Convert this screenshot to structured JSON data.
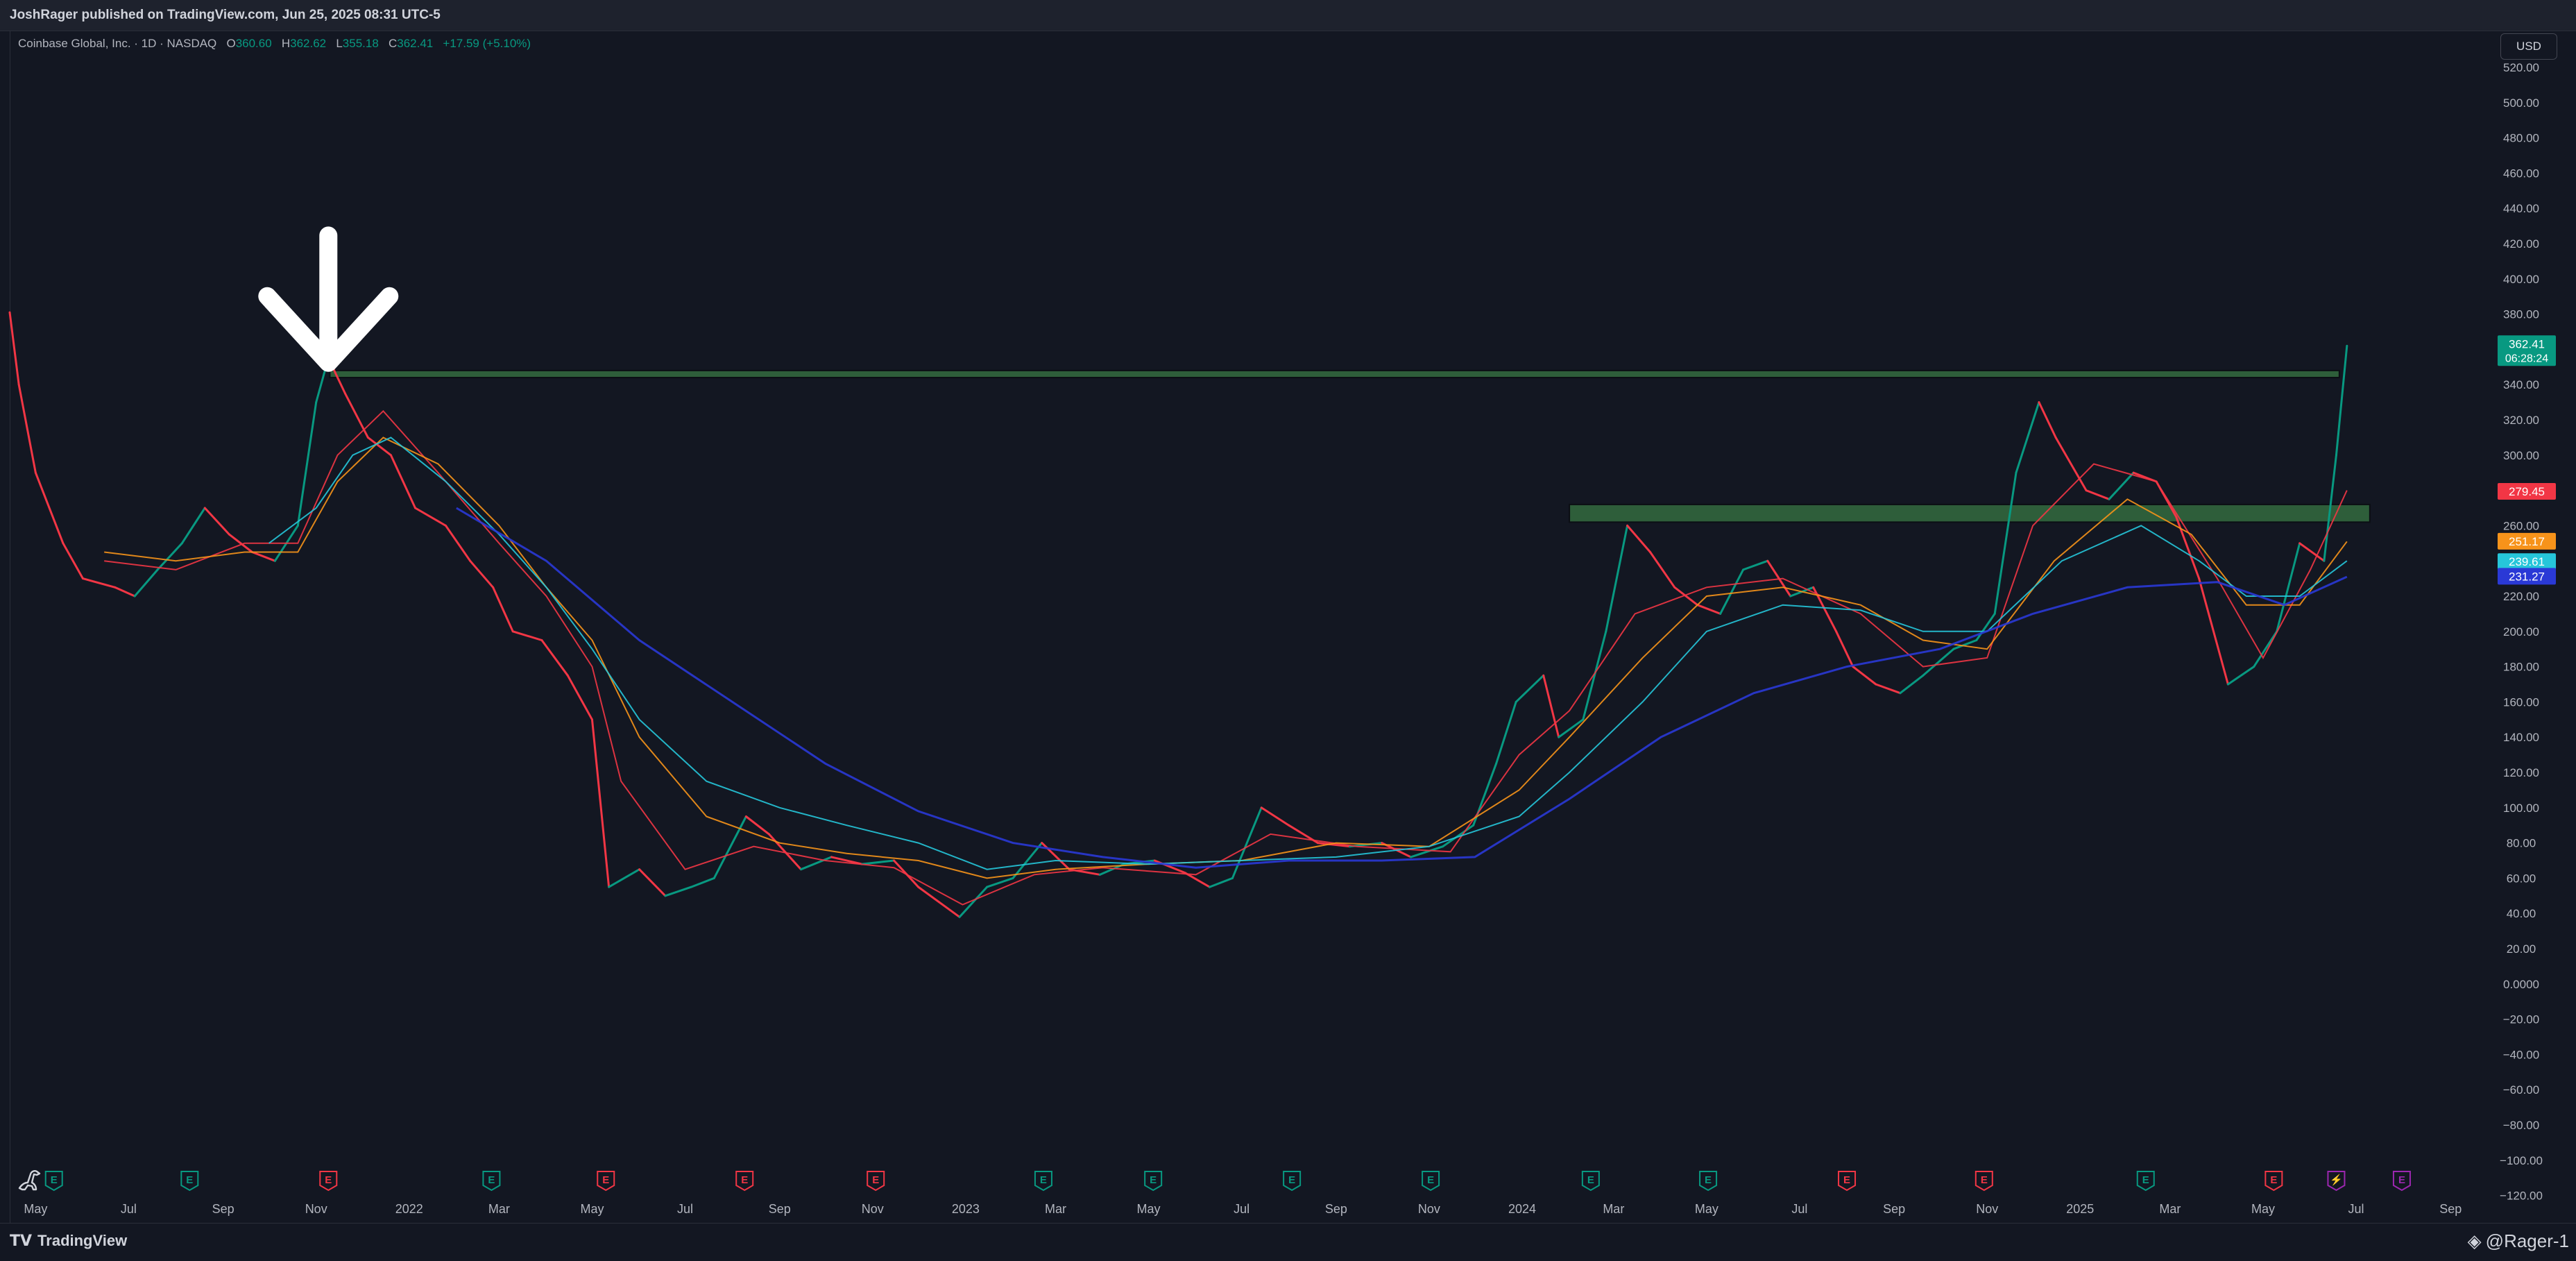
{
  "header": {
    "publish_info": "JoshRager published on TradingView.com, Jun 25, 2025 08:31 UTC-5"
  },
  "legend": {
    "symbol": "Coinbase Global, Inc. · 1D · NASDAQ",
    "open_label": "O",
    "open": "360.60",
    "high_label": "H",
    "high": "362.62",
    "low_label": "L",
    "low": "355.18",
    "close_label": "C",
    "close": "362.41",
    "change": "+17.59 (+5.10%)"
  },
  "currency": "USD",
  "footer": {
    "brand": "TradingView",
    "user": "@Rager-1"
  },
  "colors": {
    "background": "#131722",
    "up": "#089981",
    "down": "#f23645",
    "ma_red": "#f23645",
    "ma_orange": "#f7931a",
    "ma_teal": "#26c6da",
    "ma_blue": "#2a39d6",
    "zone": "#2e5e3a"
  },
  "chart_data": {
    "type": "line",
    "title": "",
    "xlabel": "",
    "ylabel": "",
    "ylim": [
      -120,
      525
    ],
    "x_range": [
      "2021-04-14",
      "2025-09-30"
    ],
    "y_ticks": [
      "520.00",
      "500.00",
      "480.00",
      "460.00",
      "440.00",
      "420.00",
      "400.00",
      "380.00",
      "360.00",
      "340.00",
      "320.00",
      "300.00",
      "280.00",
      "260.00",
      "240.00",
      "220.00",
      "200.00",
      "180.00",
      "160.00",
      "140.00",
      "120.00",
      "100.00",
      "80.00",
      "60.00",
      "40.00",
      "20.00",
      "0.0000",
      "−20.00",
      "−40.00",
      "−60.00",
      "−80.00",
      "−100.00",
      "−120.00"
    ],
    "x_ticks": [
      {
        "label": "May",
        "date": "2021-05-01"
      },
      {
        "label": "Jul",
        "date": "2021-07-01"
      },
      {
        "label": "Sep",
        "date": "2021-09-01"
      },
      {
        "label": "Nov",
        "date": "2021-11-01"
      },
      {
        "label": "2022",
        "date": "2022-01-01"
      },
      {
        "label": "Mar",
        "date": "2022-03-01"
      },
      {
        "label": "May",
        "date": "2022-05-01"
      },
      {
        "label": "Jul",
        "date": "2022-07-01"
      },
      {
        "label": "Sep",
        "date": "2022-09-01"
      },
      {
        "label": "Nov",
        "date": "2022-11-01"
      },
      {
        "label": "2023",
        "date": "2023-01-01"
      },
      {
        "label": "Mar",
        "date": "2023-03-01"
      },
      {
        "label": "May",
        "date": "2023-05-01"
      },
      {
        "label": "Jul",
        "date": "2023-07-01"
      },
      {
        "label": "Sep",
        "date": "2023-09-01"
      },
      {
        "label": "Nov",
        "date": "2023-11-01"
      },
      {
        "label": "2024",
        "date": "2024-01-01"
      },
      {
        "label": "Mar",
        "date": "2024-03-01"
      },
      {
        "label": "May",
        "date": "2024-05-01"
      },
      {
        "label": "Jul",
        "date": "2024-07-01"
      },
      {
        "label": "Sep",
        "date": "2024-09-01"
      },
      {
        "label": "Nov",
        "date": "2024-11-01"
      },
      {
        "label": "2025",
        "date": "2025-01-01"
      },
      {
        "label": "Mar",
        "date": "2025-03-01"
      },
      {
        "label": "May",
        "date": "2025-05-01"
      },
      {
        "label": "Jul",
        "date": "2025-07-01"
      },
      {
        "label": "Sep",
        "date": "2025-09-01"
      }
    ],
    "price": {
      "x": [
        "2021-04-14",
        "2021-04-20",
        "2021-05-01",
        "2021-05-19",
        "2021-06-01",
        "2021-06-22",
        "2021-07-05",
        "2021-07-20",
        "2021-08-05",
        "2021-08-20",
        "2021-09-05",
        "2021-09-20",
        "2021-10-05",
        "2021-10-20",
        "2021-11-01",
        "2021-11-09",
        "2021-11-20",
        "2021-12-05",
        "2021-12-20",
        "2022-01-05",
        "2022-01-25",
        "2022-02-10",
        "2022-02-25",
        "2022-03-10",
        "2022-03-29",
        "2022-04-15",
        "2022-05-01",
        "2022-05-12",
        "2022-06-01",
        "2022-06-18",
        "2022-07-05",
        "2022-07-20",
        "2022-08-10",
        "2022-08-25",
        "2022-09-15",
        "2022-10-05",
        "2022-10-25",
        "2022-11-15",
        "2022-12-01",
        "2022-12-28",
        "2023-01-15",
        "2023-02-01",
        "2023-02-20",
        "2023-03-10",
        "2023-03-30",
        "2023-04-15",
        "2023-05-05",
        "2023-05-25",
        "2023-06-10",
        "2023-06-25",
        "2023-07-14",
        "2023-08-01",
        "2023-08-20",
        "2023-09-10",
        "2023-10-01",
        "2023-10-20",
        "2023-11-10",
        "2023-11-30",
        "2023-12-15",
        "2023-12-28",
        "2024-01-15",
        "2024-01-25",
        "2024-02-10",
        "2024-02-25",
        "2024-03-10",
        "2024-03-25",
        "2024-04-10",
        "2024-04-25",
        "2024-05-10",
        "2024-05-25",
        "2024-06-10",
        "2024-06-25",
        "2024-07-10",
        "2024-07-25",
        "2024-08-05",
        "2024-08-20",
        "2024-09-05",
        "2024-09-20",
        "2024-10-10",
        "2024-10-25",
        "2024-11-06",
        "2024-11-20",
        "2024-12-05",
        "2024-12-16",
        "2025-01-05",
        "2025-01-20",
        "2025-02-05",
        "2025-02-20",
        "2025-03-05",
        "2025-03-20",
        "2025-04-08",
        "2025-04-25",
        "2025-05-10",
        "2025-05-25",
        "2025-06-10",
        "2025-06-18",
        "2025-06-25"
      ],
      "y": [
        381,
        340,
        290,
        250,
        230,
        225,
        220,
        235,
        250,
        270,
        255,
        245,
        240,
        260,
        330,
        355,
        335,
        310,
        300,
        270,
        260,
        240,
        225,
        200,
        195,
        175,
        150,
        55,
        65,
        50,
        55,
        60,
        95,
        85,
        65,
        72,
        68,
        70,
        55,
        38,
        55,
        60,
        80,
        65,
        62,
        68,
        70,
        63,
        55,
        60,
        100,
        90,
        80,
        78,
        80,
        72,
        78,
        90,
        125,
        160,
        175,
        140,
        150,
        200,
        260,
        245,
        225,
        215,
        210,
        235,
        240,
        220,
        225,
        200,
        180,
        170,
        165,
        175,
        190,
        195,
        210,
        290,
        330,
        310,
        280,
        275,
        290,
        285,
        265,
        230,
        170,
        180,
        200,
        250,
        240,
        300,
        362
      ]
    },
    "series": [
      {
        "color": "#f23645",
        "x": [
          "2021-06-15",
          "2021-08-01",
          "2021-09-15",
          "2021-10-20",
          "2021-11-15",
          "2021-12-15",
          "2022-01-20",
          "2022-03-01",
          "2022-04-01",
          "2022-05-01",
          "2022-05-20",
          "2022-07-01",
          "2022-08-15",
          "2022-10-01",
          "2022-11-15",
          "2022-12-30",
          "2023-02-15",
          "2023-04-01",
          "2023-06-01",
          "2023-07-20",
          "2023-09-15",
          "2023-11-15",
          "2023-12-30",
          "2024-02-01",
          "2024-03-15",
          "2024-05-01",
          "2024-06-20",
          "2024-08-10",
          "2024-09-20",
          "2024-11-01",
          "2024-12-01",
          "2025-01-10",
          "2025-02-20",
          "2025-04-01",
          "2025-05-01",
          "2025-06-01",
          "2025-06-25"
        ],
        "y": [
          240,
          235,
          250,
          250,
          300,
          325,
          290,
          250,
          220,
          180,
          115,
          65,
          78,
          70,
          66,
          45,
          62,
          66,
          62,
          85,
          78,
          75,
          130,
          155,
          210,
          225,
          230,
          210,
          180,
          185,
          260,
          295,
          285,
          230,
          185,
          235,
          280
        ]
      },
      {
        "color": "#f7931a",
        "x": [
          "2021-06-15",
          "2021-08-01",
          "2021-09-15",
          "2021-10-20",
          "2021-11-15",
          "2021-12-15",
          "2022-01-20",
          "2022-03-01",
          "2022-04-01",
          "2022-05-01",
          "2022-06-01",
          "2022-07-15",
          "2022-09-01",
          "2022-10-15",
          "2022-12-01",
          "2023-01-15",
          "2023-03-01",
          "2023-05-01",
          "2023-07-01",
          "2023-09-01",
          "2023-11-01",
          "2023-12-30",
          "2024-02-01",
          "2024-03-20",
          "2024-05-01",
          "2024-06-20",
          "2024-08-10",
          "2024-09-20",
          "2024-11-01",
          "2024-12-15",
          "2025-02-01",
          "2025-03-15",
          "2025-04-20",
          "2025-05-25",
          "2025-06-25"
        ],
        "y": [
          245,
          240,
          245,
          245,
          285,
          310,
          295,
          260,
          225,
          195,
          140,
          95,
          80,
          74,
          70,
          60,
          65,
          68,
          70,
          80,
          78,
          110,
          140,
          185,
          220,
          225,
          215,
          195,
          190,
          240,
          275,
          255,
          215,
          215,
          251
        ]
      },
      {
        "color": "#26c6da",
        "x": [
          "2021-10-01",
          "2021-11-01",
          "2021-11-25",
          "2021-12-20",
          "2022-01-25",
          "2022-03-01",
          "2022-04-01",
          "2022-05-01",
          "2022-06-01",
          "2022-07-15",
          "2022-09-01",
          "2022-10-15",
          "2022-12-01",
          "2023-01-15",
          "2023-03-01",
          "2023-05-01",
          "2023-07-01",
          "2023-09-01",
          "2023-11-01",
          "2023-12-30",
          "2024-02-01",
          "2024-03-20",
          "2024-05-01",
          "2024-06-20",
          "2024-08-10",
          "2024-09-20",
          "2024-11-01",
          "2024-12-20",
          "2025-02-10",
          "2025-03-20",
          "2025-04-20",
          "2025-05-25",
          "2025-06-25"
        ],
        "y": [
          250,
          270,
          300,
          310,
          285,
          255,
          225,
          190,
          150,
          115,
          100,
          90,
          80,
          65,
          70,
          68,
          70,
          72,
          78,
          95,
          120,
          160,
          200,
          215,
          212,
          200,
          200,
          240,
          260,
          240,
          220,
          220,
          240
        ]
      },
      {
        "color": "#2a39d6",
        "x": [
          "2022-02-01",
          "2022-04-01",
          "2022-06-01",
          "2022-08-01",
          "2022-10-01",
          "2022-12-01",
          "2023-02-01",
          "2023-04-01",
          "2023-06-01",
          "2023-08-01",
          "2023-10-01",
          "2023-12-01",
          "2024-02-01",
          "2024-04-01",
          "2024-06-01",
          "2024-08-01",
          "2024-10-01",
          "2024-12-01",
          "2025-02-01",
          "2025-04-01",
          "2025-05-15",
          "2025-06-25"
        ],
        "y": [
          270,
          240,
          195,
          160,
          125,
          98,
          80,
          72,
          66,
          70,
          70,
          72,
          105,
          140,
          165,
          180,
          190,
          210,
          225,
          228,
          215,
          231
        ]
      }
    ],
    "price_tags": [
      {
        "value": 362.41,
        "label": "362.41",
        "sub": "06:28:24",
        "color": "#089981"
      },
      {
        "value": 279.45,
        "label": "279.45",
        "color": "#f23645"
      },
      {
        "value": 251.17,
        "label": "251.17",
        "color": "#f7931a"
      },
      {
        "value": 239.61,
        "label": "239.61",
        "color": "#26c6da"
      },
      {
        "value": 231.27,
        "label": "231.27",
        "color": "#2a39d6"
      }
    ],
    "zones": [
      {
        "x0": "2021-11-10",
        "x1": "2025-06-20",
        "y0": 344,
        "y1": 348
      },
      {
        "x0": "2024-02-01",
        "x1": "2025-07-10",
        "y0": 262,
        "y1": 272
      }
    ],
    "annotation_arrow": {
      "date": "2021-11-09",
      "tip_value": 376,
      "top_value": 460
    },
    "events": [
      {
        "letter": "E",
        "date": "2021-05-13",
        "kind": "good"
      },
      {
        "letter": "E",
        "date": "2021-08-10",
        "kind": "good"
      },
      {
        "letter": "E",
        "date": "2021-11-09",
        "kind": "bad"
      },
      {
        "letter": "E",
        "date": "2022-02-24",
        "kind": "good"
      },
      {
        "letter": "E",
        "date": "2022-05-10",
        "kind": "bad"
      },
      {
        "letter": "E",
        "date": "2022-08-09",
        "kind": "bad"
      },
      {
        "letter": "E",
        "date": "2022-11-03",
        "kind": "bad"
      },
      {
        "letter": "E",
        "date": "2023-02-21",
        "kind": "good"
      },
      {
        "letter": "E",
        "date": "2023-05-04",
        "kind": "good"
      },
      {
        "letter": "E",
        "date": "2023-08-03",
        "kind": "good"
      },
      {
        "letter": "E",
        "date": "2023-11-02",
        "kind": "good"
      },
      {
        "letter": "E",
        "date": "2024-02-15",
        "kind": "good"
      },
      {
        "letter": "E",
        "date": "2024-05-02",
        "kind": "good"
      },
      {
        "letter": "E",
        "date": "2024-08-01",
        "kind": "bad"
      },
      {
        "letter": "E",
        "date": "2024-10-30",
        "kind": "bad"
      },
      {
        "letter": "E",
        "date": "2025-02-13",
        "kind": "good"
      },
      {
        "letter": "E",
        "date": "2025-05-08",
        "kind": "bad"
      },
      {
        "letter": "⚡",
        "date": "2025-06-18",
        "kind": "split"
      },
      {
        "letter": "E",
        "date": "2025-07-31",
        "kind": "future"
      }
    ]
  }
}
